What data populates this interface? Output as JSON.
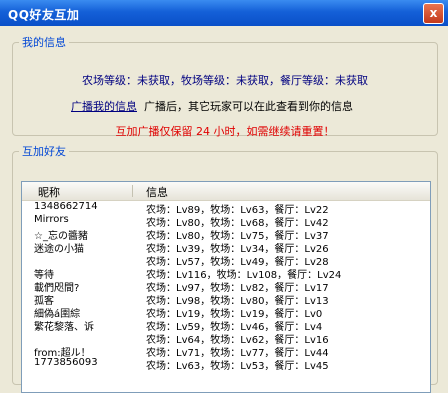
{
  "window": {
    "title": "QQ好友互加",
    "close": "x"
  },
  "my_info": {
    "legend": "我的信息",
    "levels": "农场等级：未获取，牧场等级：未获取，餐厅等级：未获取",
    "broadcast_link": "广播我的信息",
    "broadcast_text": "广播后，其它玩家可以在此查看到你的信息",
    "notice": "互加广播仅保留 24 小时，如需继续请重置！"
  },
  "friends": {
    "legend": "互加好友",
    "columns": [
      "昵称",
      "信息"
    ],
    "rows": [
      {
        "name": "1348662714",
        "info": "农场：Lv89，牧场：Lv63，餐厅：Lv22"
      },
      {
        "name": "Mirrors",
        "info": "农场：Lv80，牧场：Lv68，餐厅：Lv42"
      },
      {
        "name": "☆_忘の醬豬",
        "info": "农场：Lv80，牧场：Lv75，餐厅：Lv37"
      },
      {
        "name": "迷途の小猫",
        "info": "农场：Lv39，牧场：Lv34，餐厅：Lv26"
      },
      {
        "name": "",
        "info": "农场：Lv57，牧场：Lv49，餐厅：Lv28"
      },
      {
        "name": "等待",
        "info": "农场：Lv116，牧场：Lv108，餐厅：Lv24"
      },
      {
        "name": "載們咫間?",
        "info": "农场：Lv97，牧场：Lv82，餐厅：Lv17"
      },
      {
        "name": "孤客",
        "info": "农场：Lv98，牧场：Lv80，餐厅：Lv13"
      },
      {
        "name": "細偽á圉綜",
        "info": "农场：Lv19，牧场：Lv19，餐厅：Lv0"
      },
      {
        "name": "繁花黎落、诉",
        "info": "农场：Lv59，牧场：Lv46，餐厅：Lv4"
      },
      {
        "name": "",
        "info": "农场：Lv64，牧场：Lv62，餐厅：Lv16"
      },
      {
        "name": "from:超ル！",
        "info": "农场：Lv71，牧场：Lv77，餐厅：Lv44"
      },
      {
        "name": "1773856093",
        "info": "农场：Lv63，牧场：Lv53，餐厅：Lv45"
      }
    ]
  }
}
